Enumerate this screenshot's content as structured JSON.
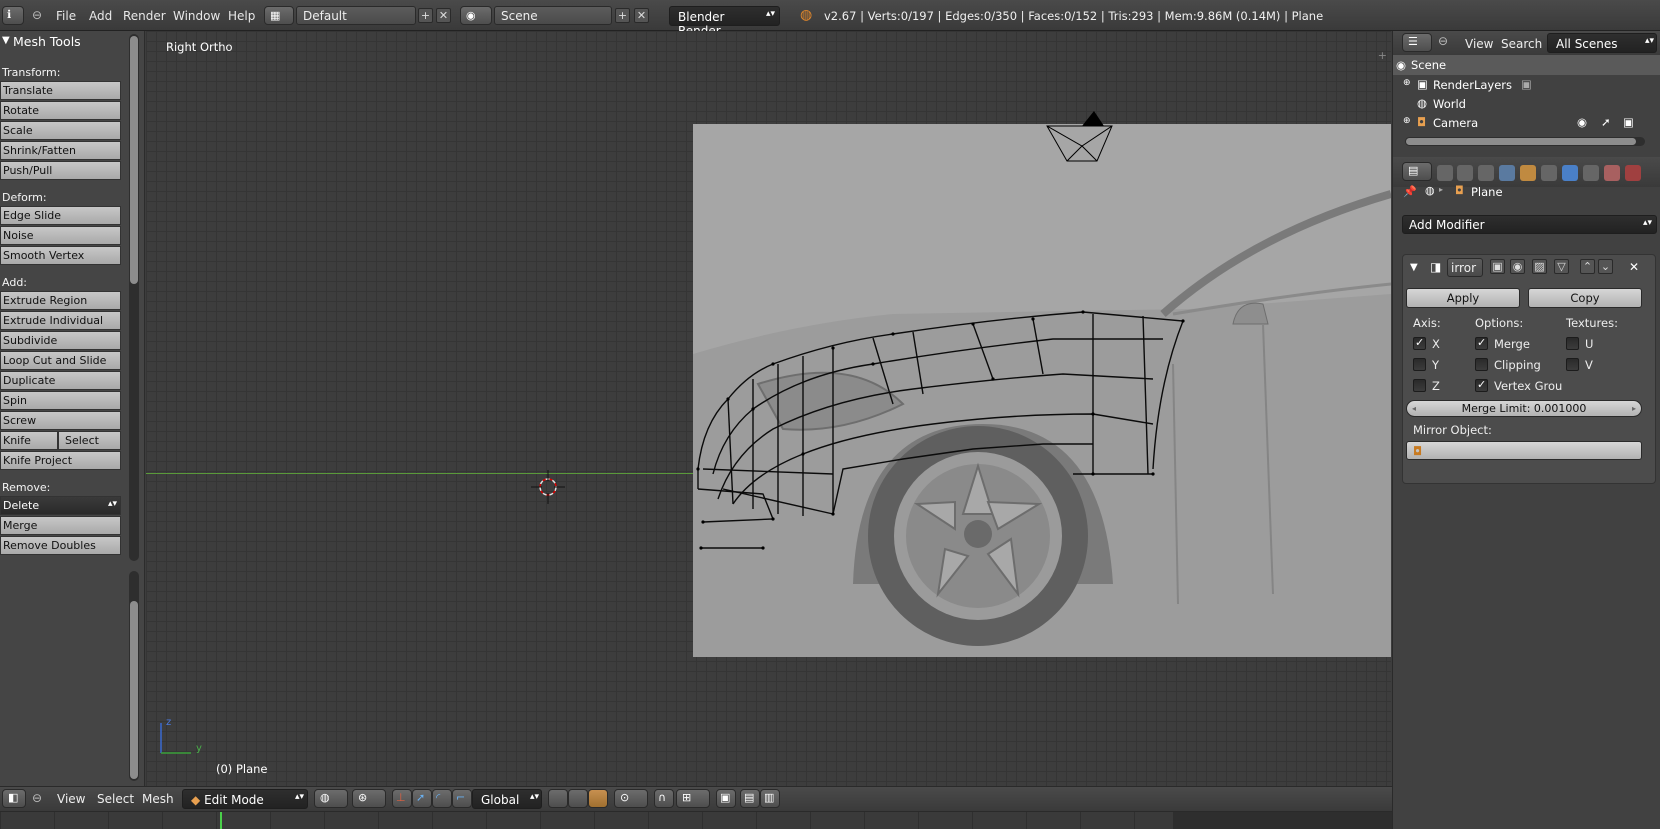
{
  "topbar": {
    "menus": [
      "File",
      "Add",
      "Render",
      "Window",
      "Help"
    ],
    "layout": "Default",
    "scene": "Scene",
    "engine": "Blender Render",
    "info": "v2.67 | Verts:0/197 | Edges:0/350 | Faces:0/152 | Tris:293 | Mem:9.86M (0.14M) | Plane"
  },
  "toolshelf": {
    "title": "Mesh Tools",
    "transform_label": "Transform:",
    "transform": [
      "Translate",
      "Rotate",
      "Scale",
      "Shrink/Fatten",
      "Push/Pull"
    ],
    "deform_label": "Deform:",
    "deform": [
      "Edge Slide",
      "Noise",
      "Smooth Vertex"
    ],
    "add_label": "Add:",
    "add": [
      "Extrude Region",
      "Extrude Individual",
      "Subdivide",
      "Loop Cut and Slide",
      "Duplicate",
      "Spin",
      "Screw"
    ],
    "knife": "Knife",
    "select": "Select",
    "knife_project": "Knife Project",
    "remove_label": "Remove:",
    "delete": "Delete",
    "merge": "Merge",
    "remove_doubles": "Remove Doubles"
  },
  "viewport": {
    "view_name": "Right Ortho",
    "object": "(0) Plane",
    "axis_z": "z",
    "axis_y": "y"
  },
  "outliner": {
    "view": "View",
    "search": "Search",
    "filter": "All Scenes",
    "items": [
      "Scene",
      "RenderLayers",
      "World",
      "Camera"
    ]
  },
  "properties": {
    "object_name": "Plane",
    "add_modifier": "Add Modifier",
    "modifier_name": "irror",
    "apply": "Apply",
    "copy": "Copy",
    "axis_label": "Axis:",
    "options_label": "Options:",
    "textures_label": "Textures:",
    "axis_x": "X",
    "axis_y": "Y",
    "axis_z": "Z",
    "merge": "Merge",
    "clipping": "Clipping",
    "vertex_groups": "Vertex Grou",
    "tex_u": "U",
    "tex_v": "V",
    "merge_limit": "Merge Limit: 0.001000",
    "mirror_object": "Mirror Object:"
  },
  "bottombar": {
    "view": "View",
    "select": "Select",
    "mesh": "Mesh",
    "mode": "Edit Mode",
    "orientation": "Global"
  }
}
